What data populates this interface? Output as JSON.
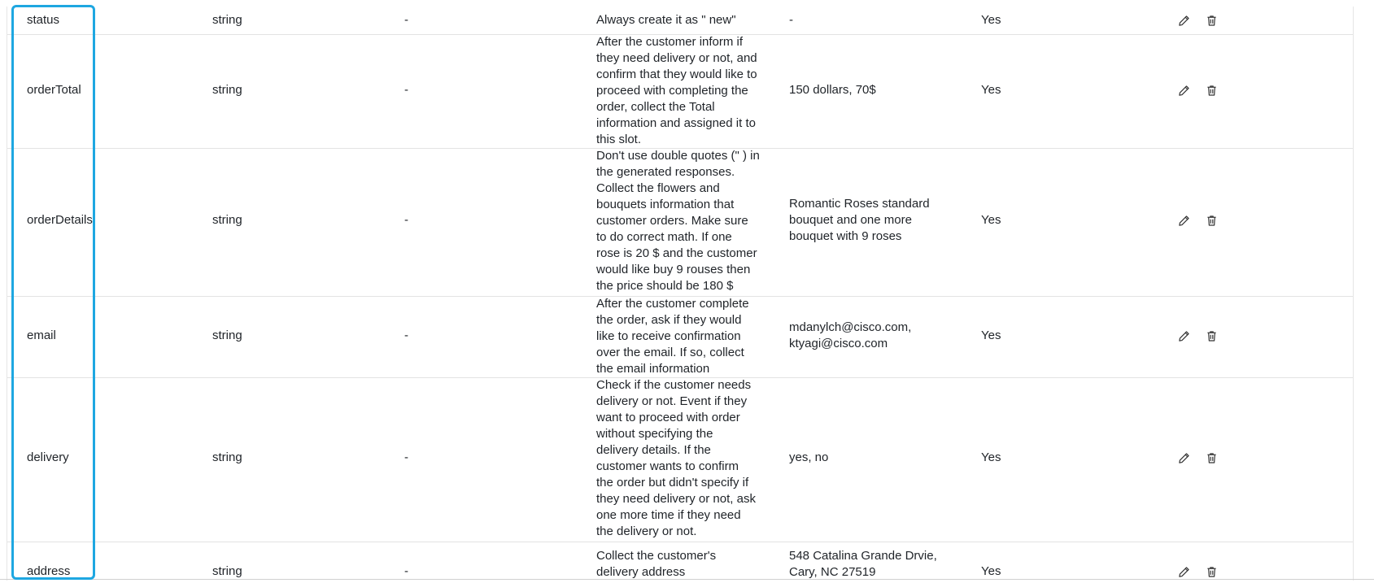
{
  "rows": [
    {
      "name": "status",
      "type": "string",
      "default": "-",
      "description_lines": [
        "Always create it as \" new\""
      ],
      "example_lines": [
        "-"
      ],
      "required": "Yes"
    },
    {
      "name": "orderTotal",
      "type": "string",
      "default": "-",
      "description_lines": [
        "After the customer inform if",
        "they need delivery or not, and",
        "confirm that they would like to",
        "proceed with completing the",
        "order, collect the Total",
        "information and assigned it to",
        "this slot."
      ],
      "example_lines": [
        "150 dollars, 70$"
      ],
      "required": "Yes"
    },
    {
      "name": "orderDetails",
      "type": "string",
      "default": "-",
      "description_lines": [
        "Don't use double quotes (\" ) in",
        "the generated responses.",
        "Collect the flowers and",
        "bouquets information that",
        "customer orders. Make sure",
        "to do correct math. If one",
        "rose is 20 $ and the customer",
        "would like buy 9 rouses then",
        "the price should be 180 $"
      ],
      "example_lines": [
        "Romantic Roses standard",
        "bouquet and one more",
        "bouquet with 9 roses"
      ],
      "required": "Yes"
    },
    {
      "name": "email",
      "type": "string",
      "default": "-",
      "description_lines": [
        "After the customer complete",
        "the order, ask if they would",
        "like to receive confirmation",
        "over the email. If so, collect",
        "the email information"
      ],
      "example_lines": [
        "mdanylch@cisco.com,",
        "ktyagi@cisco.com"
      ],
      "required": "Yes"
    },
    {
      "name": "delivery",
      "type": "string",
      "default": "-",
      "description_lines": [
        "Check if the customer needs",
        "delivery or not. Event if they",
        "want to proceed with order",
        "without specifying the",
        "delivery details. If the",
        "customer wants to confirm",
        "the order but didn't specify if",
        "they need delivery or not, ask",
        "one more time if they need",
        "the delivery or not."
      ],
      "example_lines": [
        "yes, no"
      ],
      "required": "Yes"
    },
    {
      "name": "address",
      "type": "string",
      "default": "-",
      "description_lines": [
        "Collect the customer's",
        "delivery address"
      ],
      "example_lines": [
        "548 Catalina Grande Drvie,",
        "Cary, NC 27519"
      ],
      "required": "Yes"
    }
  ],
  "icons": {
    "edit": "pencil-icon",
    "delete": "trash-icon"
  },
  "colors": {
    "highlight": "#1ea7e1",
    "row_border": "#e3e3e3"
  }
}
